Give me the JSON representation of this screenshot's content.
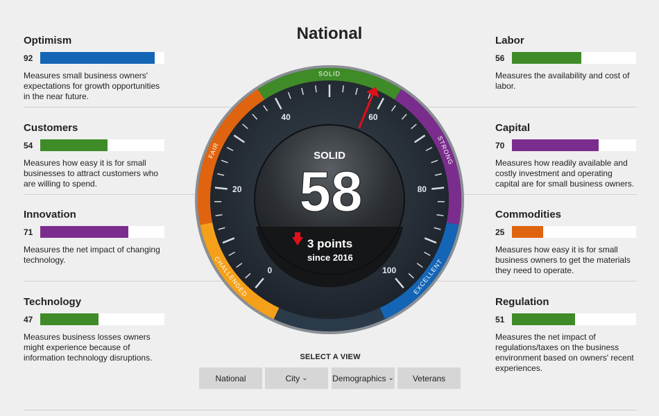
{
  "title": "National",
  "metrics_left": [
    {
      "name": "Optimism",
      "value": 92,
      "color": "#1565b6",
      "description": "Measures small business owners' expectations for growth opportunities in the near future."
    },
    {
      "name": "Customers",
      "value": 54,
      "color": "#3f8b27",
      "description": "Measures how easy it is for small businesses to attract customers who are willing to spend."
    },
    {
      "name": "Innovation",
      "value": 71,
      "color": "#7b2d8e",
      "description": "Measures the net impact of changing technology."
    },
    {
      "name": "Technology",
      "value": 47,
      "color": "#3f8b27",
      "description": "Measures business losses owners might experience because of information technology disruptions."
    }
  ],
  "metrics_right": [
    {
      "name": "Labor",
      "value": 56,
      "color": "#3f8b27",
      "description": "Measures the availability and cost of labor."
    },
    {
      "name": "Capital",
      "value": 70,
      "color": "#7b2d8e",
      "description": "Measures how readily available and costly investment and operating capital are for small business owners."
    },
    {
      "name": "Commodities",
      "value": 25,
      "color": "#e0640f",
      "description": "Measures how easy it is for small business owners to get the materials they need to operate."
    },
    {
      "name": "Regulation",
      "value": 51,
      "color": "#3f8b27",
      "description": "Measures the net impact of regulations/taxes on the business environment based on owners' recent experiences."
    }
  ],
  "gauge": {
    "status": "SOLID",
    "value": 58,
    "change": "3 points",
    "change_direction": "down",
    "change_since": "since 2016",
    "ticks": [
      "0",
      "20",
      "40",
      "60",
      "80",
      "100"
    ],
    "bands": [
      {
        "label": "CHALLENGED",
        "color": "#f5a01a",
        "from": 0,
        "to": 20
      },
      {
        "label": "FAIR",
        "color": "#e0640f",
        "from": 20,
        "to": 40
      },
      {
        "label": "SOLID",
        "color": "#3f8b27",
        "from": 40,
        "to": 60
      },
      {
        "label": "STRONG",
        "color": "#7b2d8e",
        "from": 60,
        "to": 80
      },
      {
        "label": "EXCELLENT",
        "color": "#1565b6",
        "from": 80,
        "to": 100
      }
    ],
    "needle_color": "#e0101a"
  },
  "select_view": {
    "label": "SELECT A VIEW",
    "buttons": [
      {
        "label": "National",
        "dropdown": false
      },
      {
        "label": "City",
        "dropdown": true
      },
      {
        "label": "Demographics",
        "dropdown": true
      },
      {
        "label": "Veterans",
        "dropdown": false
      }
    ]
  }
}
